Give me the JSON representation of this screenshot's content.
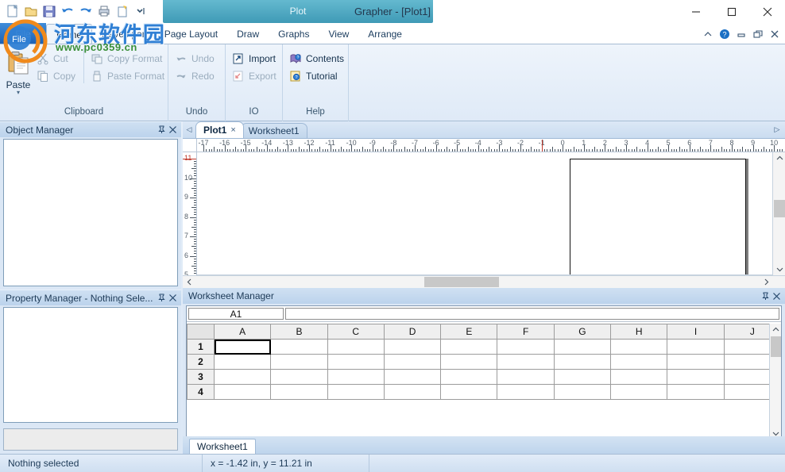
{
  "window": {
    "title": "Grapher - [Plot1]",
    "document_band_label": "Plot",
    "minimize_label": "Minimize",
    "maximize_label": "Maximize",
    "close_label": "Close"
  },
  "quick_access": {
    "items": [
      {
        "name": "new-icon",
        "label": "New"
      },
      {
        "name": "open-icon",
        "label": "Open"
      },
      {
        "name": "save-icon",
        "label": "Save"
      },
      {
        "name": "undo-icon",
        "label": "Undo"
      },
      {
        "name": "redo-icon",
        "label": "Redo"
      },
      {
        "name": "print-icon",
        "label": "Print"
      },
      {
        "name": "new-graph-icon",
        "label": "New Graph"
      },
      {
        "name": "customize-qat-icon",
        "label": "Customize Quick Access Toolbar"
      }
    ]
  },
  "ribbon": {
    "file_tab": "File",
    "tabs": [
      {
        "label": "Home",
        "active": true
      },
      {
        "label": "Developer",
        "active": false
      },
      {
        "label": "Page Layout",
        "active": false
      },
      {
        "label": "Draw",
        "active": false
      },
      {
        "label": "Graphs",
        "active": false
      },
      {
        "label": "View",
        "active": false
      },
      {
        "label": "Arrange",
        "active": false
      }
    ],
    "mdi_buttons": [
      {
        "name": "collapse-ribbon-icon",
        "label": "Collapse Ribbon"
      },
      {
        "name": "help-icon",
        "label": "Help"
      },
      {
        "name": "child-minimize-icon",
        "label": "Minimize Document"
      },
      {
        "name": "child-restore-icon",
        "label": "Restore Document"
      },
      {
        "name": "child-close-icon",
        "label": "Close Document"
      }
    ],
    "groups": [
      {
        "title": "Clipboard",
        "big": {
          "label": "Paste",
          "caret": "▾"
        },
        "small": [
          {
            "label": "Cut",
            "icon": "cut-icon",
            "disabled": true
          },
          {
            "label": "Copy",
            "icon": "copy-icon",
            "disabled": true
          }
        ],
        "small2": [
          {
            "label": "Copy Format",
            "icon": "copy-format-icon",
            "disabled": true
          },
          {
            "label": "Paste Format",
            "icon": "paste-format-icon",
            "disabled": true
          }
        ]
      },
      {
        "title": "Undo",
        "small": [
          {
            "label": "Undo",
            "icon": "undo-icon",
            "disabled": true
          },
          {
            "label": "Redo",
            "icon": "redo-icon",
            "disabled": true
          }
        ]
      },
      {
        "title": "IO",
        "small": [
          {
            "label": "Import",
            "icon": "import-icon",
            "disabled": false
          },
          {
            "label": "Export",
            "icon": "export-icon",
            "disabled": true
          }
        ]
      },
      {
        "title": "Help",
        "small": [
          {
            "label": "Contents",
            "icon": "help-contents-icon",
            "disabled": false
          },
          {
            "label": "Tutorial",
            "icon": "tutorial-icon",
            "disabled": false
          }
        ]
      }
    ]
  },
  "object_manager": {
    "title": "Object Manager",
    "pin_label": "Auto Hide",
    "close_label": "Close"
  },
  "property_manager": {
    "title": "Property Manager - Nothing Sele...",
    "pin_label": "Auto Hide",
    "close_label": "Close"
  },
  "document": {
    "nav_left": "◁",
    "nav_right": "▷",
    "tabs": [
      {
        "label": "Plot1",
        "active": true,
        "close": "×"
      },
      {
        "label": "Worksheet1",
        "active": false,
        "close": ""
      }
    ],
    "ruler_h_labels": [
      "-17",
      "-16",
      "-15",
      "-14",
      "-13",
      "-12",
      "-11",
      "-10",
      "-9",
      "-8",
      "-7",
      "-6",
      "-5",
      "-4",
      "-3",
      "-2",
      "-1",
      "0",
      "1",
      "2",
      "3",
      "4",
      "5",
      "6",
      "7",
      "8",
      "9",
      "10"
    ],
    "ruler_v_labels": [
      "11",
      "10",
      "9",
      "8",
      "7",
      "6",
      "5"
    ],
    "ruler_v_marked_index": 0
  },
  "worksheet_manager": {
    "title": "Worksheet Manager",
    "pin_label": "Auto Hide",
    "close_label": "Close",
    "name_box_value": "A1",
    "formula_value": "",
    "columns": [
      "A",
      "B",
      "C",
      "D",
      "E",
      "F",
      "G",
      "H",
      "I",
      "J"
    ],
    "rows": [
      "1",
      "2",
      "3",
      "4"
    ],
    "selected_cell": "A1",
    "sheet_tabs": [
      {
        "label": "Worksheet1",
        "active": true
      }
    ]
  },
  "status_bar": {
    "selection": "Nothing selected",
    "coordinates": "x = -1.42 in, y = 11.21 in",
    "extra": ""
  },
  "watermark": {
    "text": "河东软件园",
    "url": "www.pc0359.cn"
  },
  "colors": {
    "accent": "#1a5fb4",
    "ribbon_bg": "#eef4fb",
    "panel_header": "#bcd3ec",
    "doc_band": "#3f9ab6"
  }
}
